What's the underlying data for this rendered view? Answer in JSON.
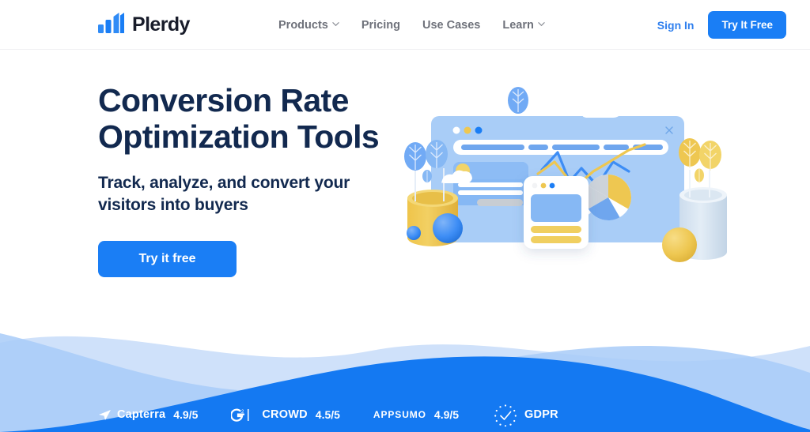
{
  "brand": {
    "name": "Plerdy",
    "logo_icon": "bar-chart-logo-icon",
    "accent_blue": "#1a7ef5",
    "dark_navy": "#12294f",
    "nav_gray": "#6f727b",
    "wave_solid": "#1479f2",
    "wave_mid": "#a8cbf8",
    "wave_light": "#cfe1fa"
  },
  "header": {
    "nav": [
      {
        "label": "Products",
        "has_dropdown": true,
        "icon": "chevron-down-icon"
      },
      {
        "label": "Pricing",
        "has_dropdown": false,
        "icon": ""
      },
      {
        "label": "Use Cases",
        "has_dropdown": false,
        "icon": ""
      },
      {
        "label": "Learn",
        "has_dropdown": true,
        "icon": "chevron-down-icon"
      }
    ],
    "sign_in": "Sign In",
    "cta": "Try It Free"
  },
  "hero": {
    "title": "Conversion Rate\nOptimization Tools",
    "subtitle": "Track, analyze, and convert your\nvisitors into buyers",
    "cta": "Try it free",
    "illustration": "analytics-dashboard-illustration"
  },
  "badges": [
    {
      "icon": "capterra-icon",
      "name": "Capterra",
      "score": "4.9/5",
      "style": "normal"
    },
    {
      "icon": "g2crowd-icon",
      "name": "CROWD",
      "score": "4.5/5",
      "style": "normal"
    },
    {
      "icon": "",
      "name": "AppSumo",
      "score": "4.9/5",
      "style": "smallcaps"
    },
    {
      "icon": "gdpr-stars-icon",
      "name": "GDPR",
      "score": "",
      "style": "normal"
    }
  ]
}
